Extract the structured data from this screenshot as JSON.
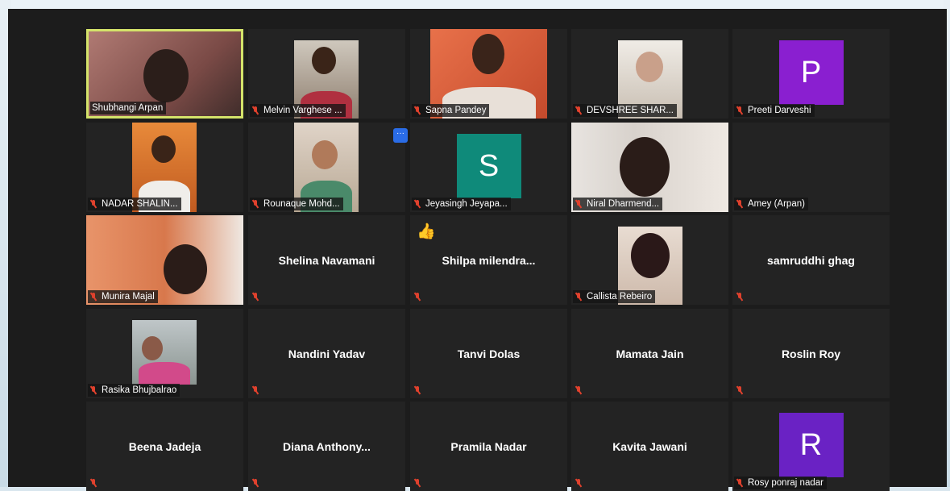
{
  "participants": [
    {
      "id": "p1",
      "label": "Shubhangi Arpan",
      "type": "video",
      "active": true,
      "muted": false
    },
    {
      "id": "p2",
      "label": "Melvin Varghese ...",
      "type": "video",
      "muted": true
    },
    {
      "id": "p3",
      "label": "Sapna Pandey",
      "type": "video",
      "muted": true
    },
    {
      "id": "p4",
      "label": "DEVSHREE SHAR...",
      "type": "video",
      "muted": true
    },
    {
      "id": "p5",
      "label": "Preeti Darveshi",
      "type": "avatar",
      "initial": "P",
      "avatar_color": "#8a1fd0",
      "muted": true
    },
    {
      "id": "p6",
      "label": "NADAR SHALIN...",
      "type": "video",
      "muted": true
    },
    {
      "id": "p7",
      "label": "Rounaque Mohd...",
      "type": "video",
      "muted": true
    },
    {
      "id": "p8",
      "label": "Jeyasingh Jeyapa...",
      "type": "avatar",
      "initial": "S",
      "avatar_color": "#0f8a7a",
      "muted": true
    },
    {
      "id": "p9",
      "label": "Niral Dharmend...",
      "type": "video",
      "muted": true
    },
    {
      "id": "p10",
      "label": "Amey (Arpan)",
      "type": "empty",
      "muted": true
    },
    {
      "id": "p11",
      "label": "Munira Majal",
      "type": "video",
      "muted": true
    },
    {
      "id": "p12",
      "name": "Shelina Navamani",
      "type": "name",
      "muted": true
    },
    {
      "id": "p13",
      "name": "Shilpa  milendra...",
      "type": "name",
      "muted": true,
      "reaction": "👍"
    },
    {
      "id": "p14",
      "label": "Callista Rebeiro",
      "type": "video",
      "muted": true
    },
    {
      "id": "p15",
      "name": "samruddhi ghag",
      "type": "name",
      "muted": true
    },
    {
      "id": "p16",
      "label": "Rasika Bhujbalrao",
      "type": "video",
      "muted": true
    },
    {
      "id": "p17",
      "name": "Nandini Yadav",
      "type": "name",
      "muted": true
    },
    {
      "id": "p18",
      "name": "Tanvi Dolas",
      "type": "name",
      "muted": true
    },
    {
      "id": "p19",
      "name": "Mamata Jain",
      "type": "name",
      "muted": true
    },
    {
      "id": "p20",
      "name": "Roslin Roy",
      "type": "name",
      "muted": true
    },
    {
      "id": "p21",
      "name": "Beena Jadeja",
      "type": "name",
      "muted": true
    },
    {
      "id": "p22",
      "name": "Diana  Anthony...",
      "type": "name",
      "muted": true
    },
    {
      "id": "p23",
      "name": "Pramila Nadar",
      "type": "name",
      "muted": true
    },
    {
      "id": "p24",
      "name": "Kavita Jawani",
      "type": "name",
      "muted": true
    },
    {
      "id": "p25",
      "label": "Rosy ponraj nadar",
      "type": "avatar",
      "initial": "R",
      "avatar_color": "#6a22c4",
      "muted": true
    }
  ],
  "colors": {
    "active_border": "#d4e36a",
    "muted_icon": "#e0412d",
    "more_button": "#2a6ce6"
  },
  "more_button_glyph": "···",
  "icons": {
    "mic_muted": "mic-muted-icon",
    "more": "more-options-icon",
    "reaction": "thumbs-up-icon"
  }
}
